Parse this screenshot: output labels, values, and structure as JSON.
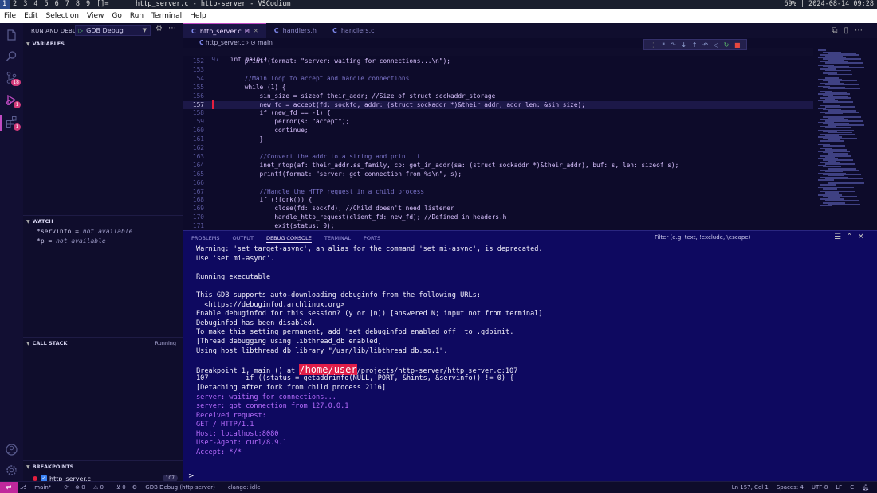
{
  "system_bar": {
    "workspaces": [
      "1",
      "2",
      "3",
      "4",
      "5",
      "6",
      "7",
      "8",
      "9",
      "[]="
    ],
    "window_title": "http_server.c - http-server - VSCodium",
    "status_right": "69% | 2024-08-14 09:28"
  },
  "menu": [
    "File",
    "Edit",
    "Selection",
    "View",
    "Go",
    "Run",
    "Terminal",
    "Help"
  ],
  "activity": {
    "source_control_badge": "18",
    "run_debug_badge": "1",
    "extensions_badge": "1"
  },
  "sidebar": {
    "run_and_debug_label": "RUN AND DEBUG",
    "config_name": "GDB Debug",
    "variables_header": "VARIABLES",
    "watch_header": "WATCH",
    "watch_items": [
      {
        "expr": "*servinfo = ",
        "value": "not available"
      },
      {
        "expr": "*p = ",
        "value": "not available"
      }
    ],
    "call_stack_header": "CALL STACK",
    "call_stack_status": "Running",
    "breakpoints_header": "BREAKPOINTS",
    "breakpoint_file": "http_server.c",
    "breakpoint_count": "107"
  },
  "tabs": [
    {
      "label": "http_server.c",
      "modified": "M",
      "active": true
    },
    {
      "label": "handlers.h",
      "active": false
    },
    {
      "label": "handlers.c",
      "active": false
    }
  ],
  "breadcrumb": {
    "file": "http_server.c",
    "symbol": "main"
  },
  "code": {
    "sticky": {
      "line": "97",
      "text": "int main() {"
    },
    "lines": [
      {
        "n": "152",
        "text": "    printf(format: \"server: waiting for connections...\\n\");"
      },
      {
        "n": "153",
        "text": ""
      },
      {
        "n": "154",
        "text": "    //Main loop to accept and handle connections"
      },
      {
        "n": "155",
        "text": "    while (1) {"
      },
      {
        "n": "156",
        "text": "        sin_size = sizeof their_addr; //Size of struct sockaddr_storage"
      },
      {
        "n": "157",
        "text": "        new_fd = accept(fd: sockfd, addr: (struct sockaddr *)&their_addr, addr_len: &sin_size);"
      },
      {
        "n": "158",
        "text": "        if (new_fd == -1) {"
      },
      {
        "n": "159",
        "text": "            perror(s: \"accept\");"
      },
      {
        "n": "160",
        "text": "            continue;"
      },
      {
        "n": "161",
        "text": "        }"
      },
      {
        "n": "162",
        "text": ""
      },
      {
        "n": "163",
        "text": "        //Convert the addr to a string and print it"
      },
      {
        "n": "164",
        "text": "        inet_ntop(af: their_addr.ss_family, cp: get_in_addr(sa: (struct sockaddr *)&their_addr), buf: s, len: sizeof s);"
      },
      {
        "n": "165",
        "text": "        printf(format: \"server: got connection from %s\\n\", s);"
      },
      {
        "n": "166",
        "text": ""
      },
      {
        "n": "167",
        "text": "        //Handle the HTTP request in a child process"
      },
      {
        "n": "168",
        "text": "        if (!fork()) {"
      },
      {
        "n": "169",
        "text": "            close(fd: sockfd); //Child doesn't need listener"
      },
      {
        "n": "170",
        "text": "            handle_http_request(client_fd: new_fd); //Defined in headers.h"
      },
      {
        "n": "171",
        "text": "            exit(status: 0);"
      }
    ],
    "current_line": "157"
  },
  "panel": {
    "tabs": [
      "PROBLEMS",
      "OUTPUT",
      "DEBUG CONSOLE",
      "TERMINAL",
      "PORTS"
    ],
    "active_tab": "DEBUG CONSOLE",
    "filter_placeholder": "Filter (e.g. text, !exclude, \\escape)",
    "console": [
      {
        "t": "Warning: 'set target-async', an alias for the command 'set mi-async', is deprecated.",
        "k": "gdb"
      },
      {
        "t": "Use 'set mi-async'.",
        "k": "gdb"
      },
      {
        "t": "",
        "k": "gdb"
      },
      {
        "t": "Running executable",
        "k": "gdb"
      },
      {
        "t": "",
        "k": "gdb"
      },
      {
        "t": "This GDB supports auto-downloading debuginfo from the following URLs:",
        "k": "gdb"
      },
      {
        "t": "  <https://debuginfod.archlinux.org>",
        "k": "gdb"
      },
      {
        "t": "Enable debuginfod for this session? (y or [n]) [answered N; input not from terminal]",
        "k": "gdb"
      },
      {
        "t": "Debuginfod has been disabled.",
        "k": "gdb"
      },
      {
        "t": "To make this setting permanent, add 'set debuginfod enabled off' to .gdbinit.",
        "k": "gdb"
      },
      {
        "t": "[Thread debugging using libthread_db enabled]",
        "k": "gdb"
      },
      {
        "t": "Using host libthread_db library \"/usr/lib/libthread_db.so.1\".",
        "k": "gdb"
      },
      {
        "t": "",
        "k": "gdb"
      },
      {
        "t": "",
        "k": "bp"
      },
      {
        "t": "107         if ((status = getaddrinfo(NULL, PORT, &hints, &servinfo)) != 0) {",
        "k": "gdb"
      },
      {
        "t": "[Detaching after fork from child process 2116]",
        "k": "gdb"
      },
      {
        "t": "server: waiting for connections...",
        "k": "out"
      },
      {
        "t": "server: got connection from 127.0.0.1",
        "k": "out"
      },
      {
        "t": "Received request:",
        "k": "out"
      },
      {
        "t": "GET / HTTP/1.1",
        "k": "out"
      },
      {
        "t": "Host: localhost:8080",
        "k": "out"
      },
      {
        "t": "User-Agent: curl/8.9.1",
        "k": "out"
      },
      {
        "t": "Accept: */*",
        "k": "out"
      }
    ],
    "breakpoint_line": {
      "prefix": "Breakpoint 1, main () at ",
      "highlight": "/home/user",
      "suffix": "/projects/http-server/http_server.c:107"
    },
    "prompt": ">"
  },
  "status": {
    "branch": "main*",
    "errors": "0",
    "warnings": "0",
    "debug": "GDB Debug (http-server)",
    "clangd": "clangd: idle",
    "position": "Ln 157, Col 1",
    "spaces": "Spaces: 4",
    "encoding": "UTF-8",
    "eol": "LF",
    "language": "C"
  },
  "colors": {
    "accent": "#c04bc3",
    "panel_bg": "#0e0960",
    "editor_bg": "#0d0b2a",
    "output_text": "#b86dff",
    "highlight": "#e11d48"
  }
}
